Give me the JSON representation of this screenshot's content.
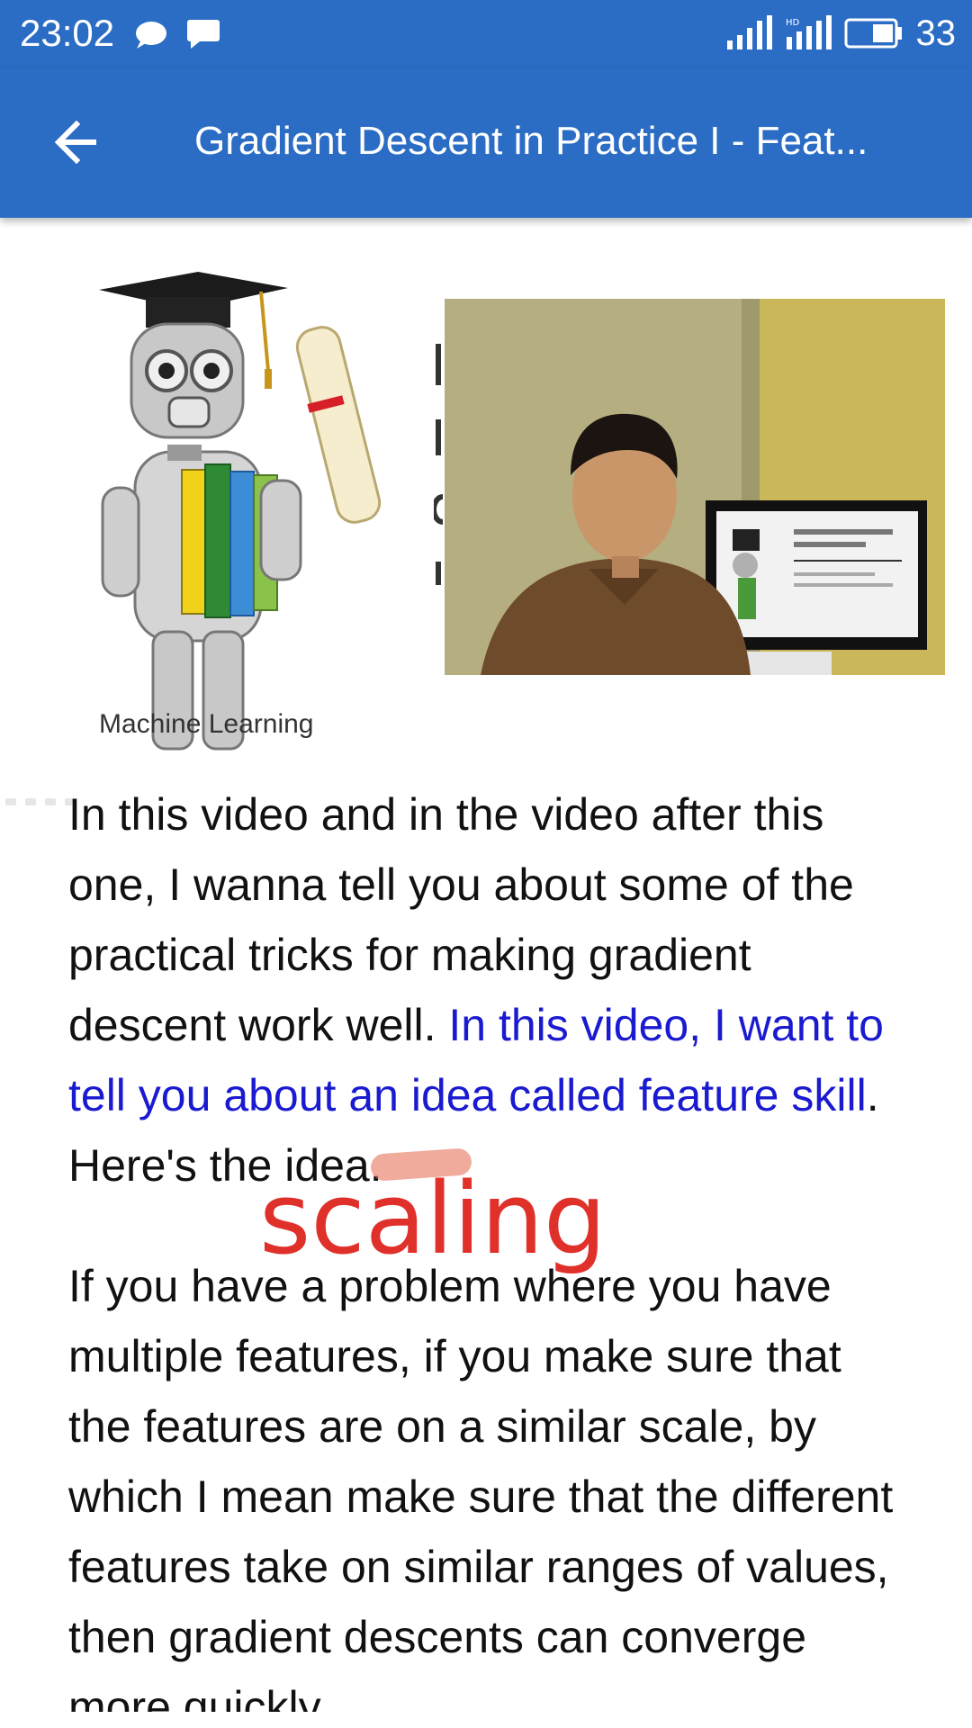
{
  "status_bar": {
    "time": "23:02",
    "battery_level": "33",
    "icons": [
      "chat-bubble-icon",
      "message-icon",
      "signal-icon",
      "hd-signal-icon",
      "battery-icon"
    ]
  },
  "app_bar": {
    "back_icon": "arrow-left-icon",
    "title": "Gradient Descent in Practice I - Feat..."
  },
  "video": {
    "course_caption": "Machine Learning",
    "slide_title": "Linear Regression with multiple variables",
    "slide_subtitle": "Gradient descent in practice I: Feature Scaling"
  },
  "transcript": {
    "p1_normal": "In this video and in the video after this one, I wanna tell you about some of the practical tricks for making gradient descent work well. ",
    "p1_highlight_a": "In this video, I want to tell you about an idea called feature ",
    "p1_highlight_word": "skill",
    "p1_tail": ". Here's the idea.",
    "p2": "If you have a problem where you have multiple features, if you make sure that the features are on a similar scale, by which I mean make sure that the different features take on similar ranges of values, then gradient descents can converge more quickly."
  },
  "annotation": {
    "correction": "scaling",
    "color": "#e0302a"
  },
  "colors": {
    "app_bar": "#2b6cc4",
    "highlight_text": "#1a1ad0",
    "body_text": "#111111"
  }
}
